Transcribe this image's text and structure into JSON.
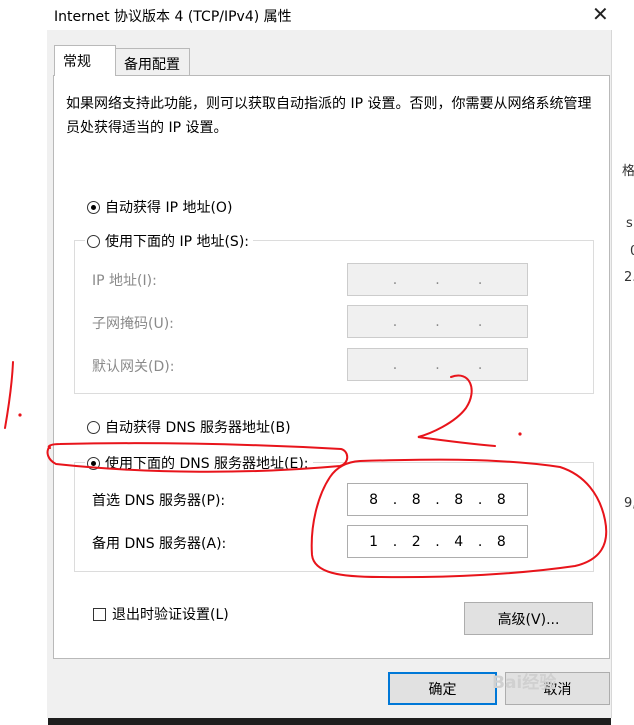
{
  "window": {
    "title": "Internet 协议版本 4 (TCP/IPv4) 属性",
    "close_glyph": "✕"
  },
  "tabs": [
    {
      "label": "常规",
      "active": true
    },
    {
      "label": "备用配置",
      "active": false
    }
  ],
  "description": "如果网络支持此功能，则可以获取自动指派的 IP 设置。否则，你需要从网络系统管理员处获得适当的 IP 设置。",
  "ip_section": {
    "auto_label": "自动获得 IP 地址(O)",
    "manual_label": "使用下面的 IP 地址(S):",
    "selected": "auto",
    "fields": [
      {
        "label": "IP 地址(I):",
        "value": [
          "",
          "",
          "",
          ""
        ]
      },
      {
        "label": "子网掩码(U):",
        "value": [
          "",
          "",
          "",
          ""
        ]
      },
      {
        "label": "默认网关(D):",
        "value": [
          "",
          "",
          "",
          ""
        ]
      }
    ]
  },
  "dns_section": {
    "auto_label": "自动获得 DNS 服务器地址(B)",
    "manual_label": "使用下面的 DNS 服务器地址(E):",
    "selected": "manual",
    "preferred": {
      "label": "首选 DNS 服务器(P):",
      "value": [
        "8",
        "8",
        "8",
        "8"
      ]
    },
    "alternate": {
      "label": "备用 DNS 服务器(A):",
      "value": [
        "1",
        "2",
        "4",
        "8"
      ]
    }
  },
  "validate_checkbox": {
    "label": "退出时验证设置(L)",
    "checked": false
  },
  "buttons": {
    "advanced": "高级(V)...",
    "ok": "确定",
    "cancel": "取消"
  },
  "background_fragments": [
    "格",
    "s",
    "0",
    "2.",
    "9,"
  ],
  "annotations": {
    "step_number": "1.",
    "color": "#e8141b"
  },
  "watermark": "Bai经验",
  "colors": {
    "focus_border": "#0078d7",
    "dialog_bg": "#f0f0f0"
  }
}
